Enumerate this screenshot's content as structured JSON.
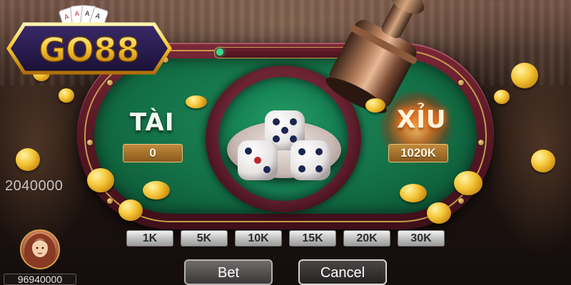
{
  "brand": {
    "logo_text": "GO88"
  },
  "tai": {
    "label": "TÀI",
    "bet": "0"
  },
  "xiu": {
    "label": "XỈU",
    "bet": "1020K"
  },
  "pot_left": "2040000",
  "chips": [
    "1K",
    "5K",
    "10K",
    "15K",
    "20K",
    "30K"
  ],
  "actions": {
    "bet": "Bet",
    "cancel": "Cancel"
  },
  "player": {
    "balance": "96940000"
  },
  "dice": [
    5,
    3,
    4
  ],
  "colors": {
    "felt": "#137046",
    "table": "#5a1826",
    "gold": "#c08a3b",
    "xiu_glow": "#ff5a10"
  }
}
